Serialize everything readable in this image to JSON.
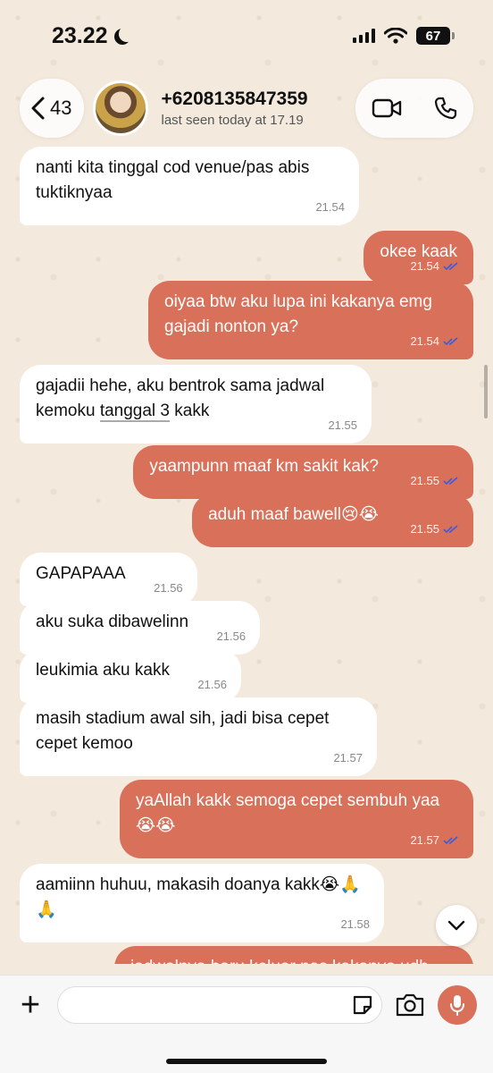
{
  "status_bar": {
    "time": "23.22",
    "battery": "67"
  },
  "header": {
    "back_count": "43",
    "contact_name": "+6208135847359",
    "contact_status": "last seen today at 17.19"
  },
  "messages": [
    {
      "dir": "in",
      "text": "nanti kita tinggal cod venue/pas abis tuktiknyaa",
      "time": "21.54"
    },
    {
      "dir": "out",
      "text": "okee kaak",
      "time": "21.54"
    },
    {
      "dir": "out",
      "text": "oiyaa btw aku lupa ini kakanya emg gajadi nonton ya?",
      "time": "21.54"
    },
    {
      "dir": "in",
      "text_pre": "gajadii hehe, aku bentrok sama jadwal kemoku ",
      "text_underlined": "tanggal 3",
      "text_post": " kakk",
      "time": "21.55"
    },
    {
      "dir": "out",
      "text": "yaampunn maaf km sakit kak?",
      "time": "21.55"
    },
    {
      "dir": "out",
      "text": "aduh maaf bawell😢😭",
      "time": "21.55"
    },
    {
      "dir": "in",
      "text": "GAPAPAAA",
      "time": "21.56"
    },
    {
      "dir": "in",
      "text": "aku suka dibawelinn",
      "time": "21.56"
    },
    {
      "dir": "in",
      "text": "leukimia aku kakk",
      "time": "21.56"
    },
    {
      "dir": "in",
      "text": "masih stadium awal sih, jadi bisa cepet cepet kemoo",
      "time": "21.57"
    },
    {
      "dir": "out",
      "text": "yaAllah kakk semoga cepet sembuh yaa 😭😭",
      "time": "21.57"
    },
    {
      "dir": "in",
      "text": "aamiinn huhuu, makasih doanya kakk😭🙏🙏",
      "time": "21.58"
    },
    {
      "dir": "out",
      "text": "jadwalnya baru keluar pas kakanya udh",
      "time": ""
    }
  ],
  "input": {
    "placeholder": ""
  },
  "colors": {
    "outgoing_bubble": "#d9715a",
    "incoming_bubble": "#ffffff",
    "tick_color": "#3b5bdb"
  },
  "icons": [
    "back-chevron-icon",
    "video-call-icon",
    "phone-icon",
    "moon-icon",
    "signal-icon",
    "wifi-icon",
    "plus-icon",
    "sticker-icon",
    "camera-icon",
    "mic-icon",
    "chevron-down-icon",
    "double-tick-icon"
  ]
}
